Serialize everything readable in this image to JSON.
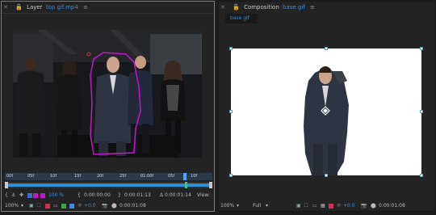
{
  "layer_panel": {
    "tab_prefix": "Layer",
    "tab_name": "top gif.mp4",
    "ruler_ticks": [
      "00f",
      "05f",
      "10f",
      "15f",
      "20f",
      "25f",
      "01:00f",
      "05f",
      "10f"
    ],
    "zoom": "100%",
    "opacity": "100 %",
    "time_in": "0:00:00:00",
    "time_out": "0:00:01:13",
    "duration": "Δ 0:00:01:14",
    "view_label": "View:",
    "bottom_zoom": "100%",
    "exposure": "+0.0",
    "current_time": "0:00:01:08"
  },
  "comp_panel": {
    "tab_prefix": "Composition",
    "tab_name": "base gif",
    "sub_tab": "base gif",
    "zoom": "100%",
    "resolution": "Full",
    "exposure": "+0.0",
    "current_time": "0:00:01:08"
  },
  "colors": {
    "accent": "#2d8cff",
    "mask_outline": "#c018c8",
    "timeline_bar": "#2f8fd6",
    "playhead_green": "#2fd06a"
  }
}
